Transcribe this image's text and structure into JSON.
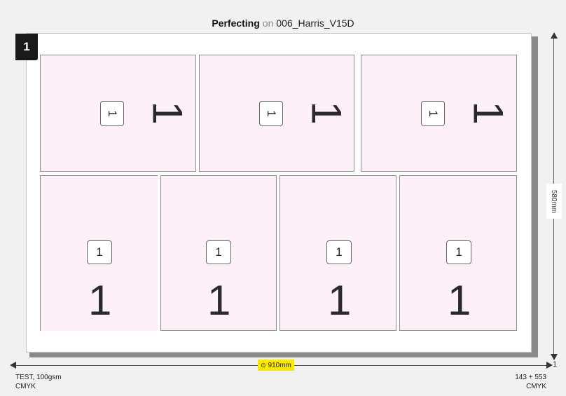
{
  "header": {
    "mode": "Perfecting",
    "connector": "on",
    "press": "006_Harris_V15D"
  },
  "sheet": {
    "number": "1"
  },
  "pages": {
    "top": [
      {
        "badge": "1",
        "big": "1"
      },
      {
        "badge": "1",
        "big": "1"
      },
      {
        "badge": "1",
        "big": "1"
      }
    ],
    "bottom": [
      {
        "badge": "1",
        "big": "1"
      },
      {
        "badge": "1",
        "big": "1"
      },
      {
        "badge": "1",
        "big": "1"
      },
      {
        "badge": "1",
        "big": "1"
      }
    ]
  },
  "dimensions": {
    "width": "910mm",
    "height": "580mm",
    "side_count": "1"
  },
  "footer": {
    "left_stock": "TEST, 100gsm",
    "left_color": "CMYK",
    "right_offset": "143 + 553",
    "right_color": "CMYK"
  }
}
